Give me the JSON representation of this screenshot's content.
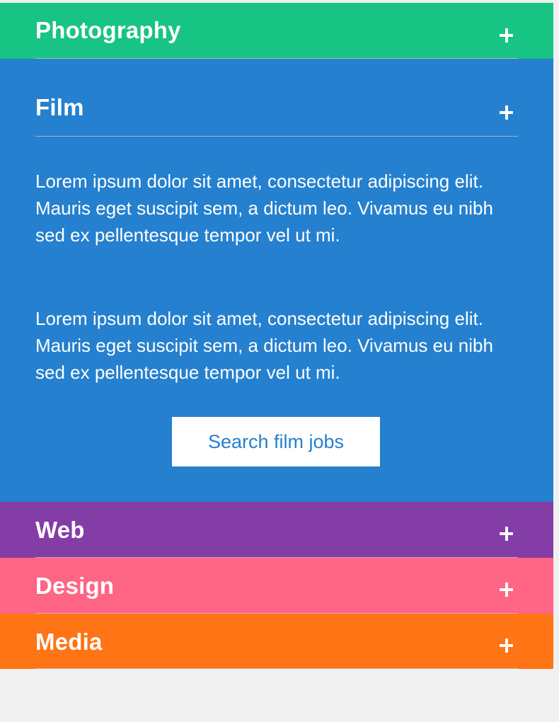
{
  "accordion": {
    "sections": [
      {
        "title": "Photography",
        "color": "#18c484",
        "expanded": false,
        "icon": "plus-icon"
      },
      {
        "title": "Film",
        "color": "#2580cf",
        "expanded": true,
        "icon": "plus-icon",
        "paragraphs": [
          "Lorem ipsum dolor sit amet, consectetur adipiscing elit. Mauris eget suscipit sem, a dictum leo. Vivamus eu nibh sed ex pellentesque tempor vel ut mi.",
          "Lorem ipsum dolor sit amet, consectetur adipiscing elit. Mauris eget suscipit sem, a dictum leo. Vivamus eu nibh sed ex pellentesque tempor vel ut mi."
        ],
        "button_label": "Search film jobs",
        "button_text_color": "#2580cf"
      },
      {
        "title": "Web",
        "color": "#843ca7",
        "expanded": false,
        "icon": "plus-icon"
      },
      {
        "title": "Design",
        "color": "#ff6585",
        "expanded": false,
        "icon": "plus-icon"
      },
      {
        "title": "Media",
        "color": "#ff7414",
        "expanded": false,
        "icon": "plus-icon"
      }
    ]
  }
}
